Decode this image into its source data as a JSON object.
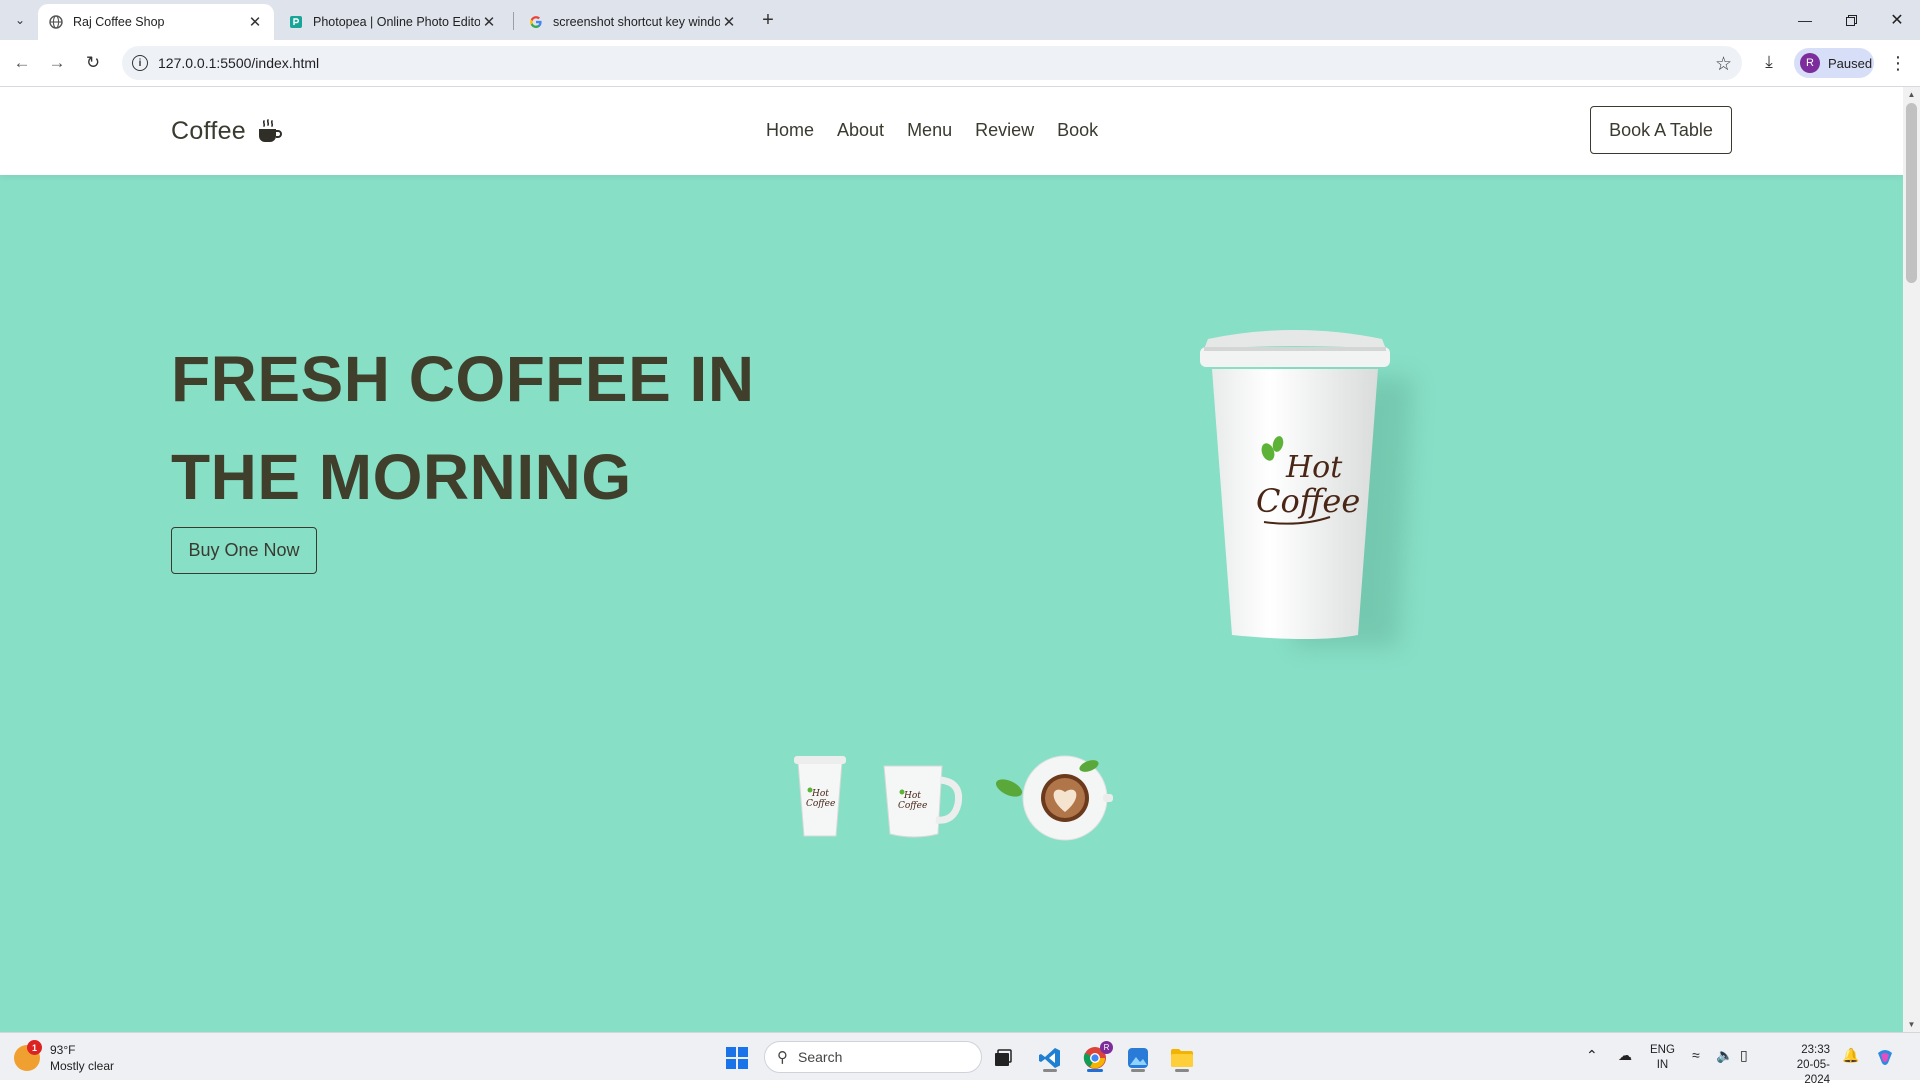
{
  "browser": {
    "tabs": [
      {
        "title": "Raj Coffee Shop",
        "active": true,
        "favicon": "globe-icon"
      },
      {
        "title": "Photopea | Online Photo Editor",
        "active": false,
        "favicon": "photopea-icon"
      },
      {
        "title": "screenshot shortcut key windo",
        "active": false,
        "favicon": "google-icon"
      }
    ],
    "url": "127.0.0.1:5500/index.html",
    "profile_initial": "R",
    "profile_status": "Paused",
    "colors": {
      "frame": "#dfe3ec",
      "profile_bg": "#d7def7",
      "avatar": "#7d2c9c"
    }
  },
  "site": {
    "logo_text": "Coffee",
    "nav": [
      "Home",
      "About",
      "Menu",
      "Review",
      "Book"
    ],
    "cta": "Book A Table",
    "hero_title": "FRESH COFFEE IN THE MORNING",
    "hero_button": "Buy One Now",
    "cup_brand_line1": "Hot",
    "cup_brand_line2": "Coffee",
    "colors": {
      "hero_bg": "#87dfc6",
      "text": "#3f3f2c",
      "brand_green": "#5cb338",
      "brand_brown": "#4a2616"
    }
  },
  "taskbar": {
    "weather_temp": "93°F",
    "weather_desc": "Mostly clear",
    "weather_badge": "1",
    "search_placeholder": "Search",
    "lang_line1": "ENG",
    "lang_line2": "IN",
    "time": "23:33",
    "date": "20-05-2024",
    "chrome_badge": "R"
  }
}
